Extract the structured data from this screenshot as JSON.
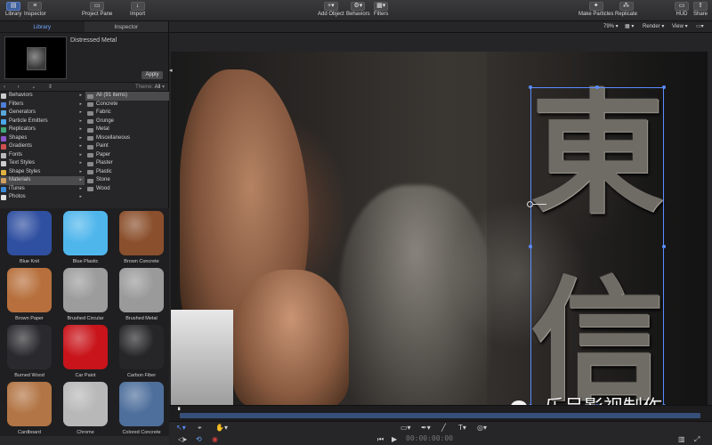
{
  "toolbar": {
    "library": "Library",
    "inspector": "Inspector",
    "project_pane": "Project Pane",
    "import": "Import",
    "add_object": "Add Object",
    "behaviors": "Behaviors",
    "filters": "Filters",
    "make_particles": "Make Particles",
    "replicate": "Replicate",
    "hud": "HUD",
    "share": "Share"
  },
  "left_panel": {
    "tabs": [
      "Library",
      "Inspector"
    ],
    "preview_name": "Distressed Metal",
    "apply_label": "Apply",
    "theme_label": "Theme:",
    "theme_value": "All",
    "categories": [
      {
        "label": "Behaviors",
        "color": "#cccccc"
      },
      {
        "label": "Filters",
        "color": "#4f7fd8"
      },
      {
        "label": "Generators",
        "color": "#58a7d8"
      },
      {
        "label": "Particle Emitters",
        "color": "#4aa7e8"
      },
      {
        "label": "Replicators",
        "color": "#3fa87a"
      },
      {
        "label": "Shapes",
        "color": "#8a58c8"
      },
      {
        "label": "Gradients",
        "color": "#d05050"
      },
      {
        "label": "Fonts",
        "color": "#bbbbbb"
      },
      {
        "label": "Text Styles",
        "color": "#cccccc"
      },
      {
        "label": "Shape Styles",
        "color": "#e0b040"
      },
      {
        "label": "Materials",
        "color": "#d0a060"
      },
      {
        "label": "iTunes",
        "color": "#3a8ad8"
      },
      {
        "label": "Photos",
        "color": "#e0e0e0"
      }
    ],
    "materials": [
      "All (91 items)",
      "Concrete",
      "Fabric",
      "Grunge",
      "Metal",
      "Miscellaneous",
      "Paint",
      "Paper",
      "Plaster",
      "Plastic",
      "Stone",
      "Wood"
    ],
    "swatches": [
      {
        "label": "Blue Knit",
        "color": "#2f4fa0"
      },
      {
        "label": "Blue Plastic",
        "color": "#4fb6ec"
      },
      {
        "label": "Brown Concrete",
        "color": "#8a4f2c"
      },
      {
        "label": "Brown Paper",
        "color": "#b7703d"
      },
      {
        "label": "Brushed Circular",
        "color": "#9c9c9c"
      },
      {
        "label": "Brushed Metal",
        "color": "#9a9a9a"
      },
      {
        "label": "Burned Wood",
        "color": "#2a2a2e"
      },
      {
        "label": "Car Paint",
        "color": "#c8141a"
      },
      {
        "label": "Carbon Fiber",
        "color": "#262628"
      },
      {
        "label": "Cardboard",
        "color": "#b27545"
      },
      {
        "label": "Chrome",
        "color": "#b8b8b8"
      },
      {
        "label": "Colored Concrete",
        "color": "#4e6f9c"
      }
    ]
  },
  "canvas": {
    "zoom": "79%",
    "render": "Render",
    "view": "View",
    "glyph_top": "東",
    "glyph_bottom": "信"
  },
  "watermark": "乐呈影视制作",
  "timecode": "00:00:00:00"
}
